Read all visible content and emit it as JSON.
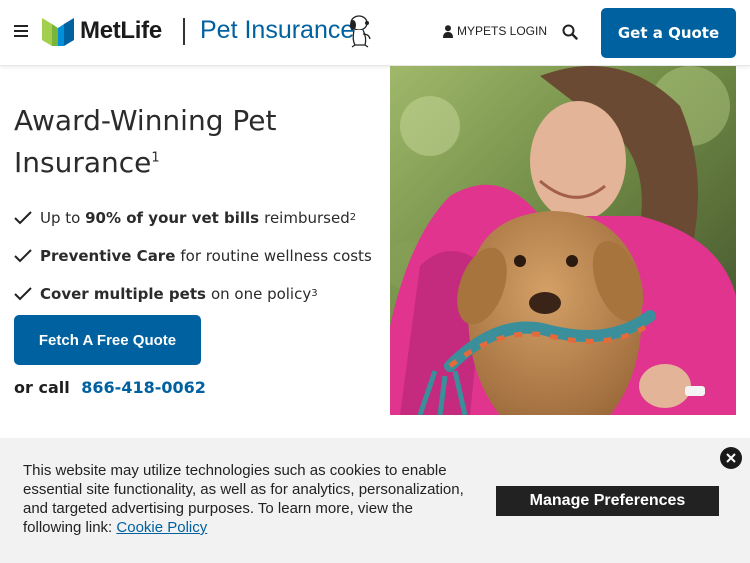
{
  "header": {
    "brand": "MetLife",
    "product": "Pet Insurance",
    "login_label": "MYPETS LOGIN",
    "quote_button": "Get a Quote"
  },
  "hero": {
    "title": "Award-Winning Pet Insurance",
    "title_footnote": "1",
    "benefits": [
      {
        "pre": "Up to ",
        "bold": "90% of your vet bills",
        "post": " reimbursed",
        "footnote": "2"
      },
      {
        "pre": "",
        "bold": "Preventive Care",
        "post": "for routine wellness costs",
        "footnote": ""
      },
      {
        "pre": "",
        "bold": "Cover multiple pets",
        "post": "on one policy",
        "footnote": "3"
      }
    ],
    "cta_button": "Fetch A Free Quote",
    "call_label": "or call",
    "phone": "866-418-0062"
  },
  "cookie_banner": {
    "text": "This website may utilize technologies such as cookies to enable essential site functionality, as well as for analytics, personalization, and targeted advertising purposes. To learn more, view the following link:",
    "link_label": "Cookie Policy",
    "manage_button": "Manage Preferences"
  },
  "colors": {
    "brand_blue": "#0061a0",
    "logo_green": "#a4ce4e",
    "logo_blue": "#0090da",
    "dark_button": "#222222",
    "banner_bg": "#f2f2f2"
  },
  "icons": [
    "menu-icon",
    "metlife-logo-icon",
    "snoopy-icon",
    "user-icon",
    "search-icon",
    "check-icon",
    "close-icon"
  ]
}
